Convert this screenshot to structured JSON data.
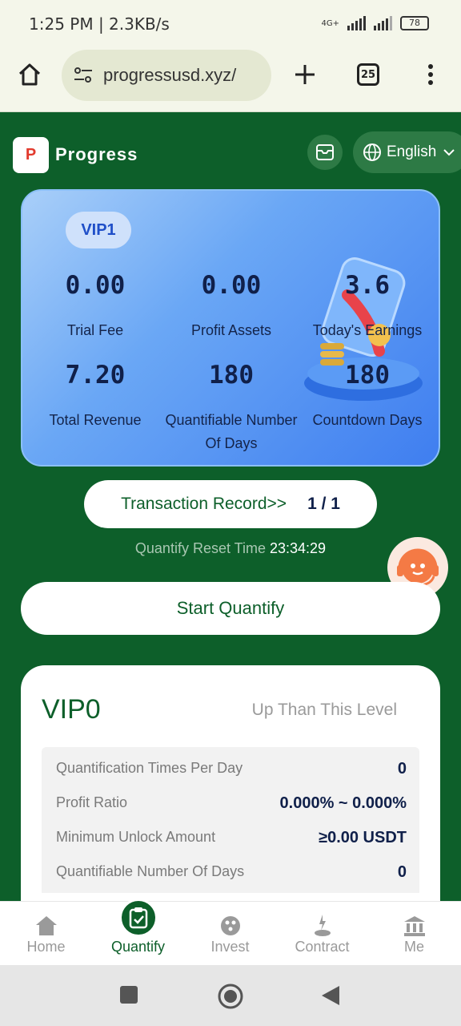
{
  "status_bar": {
    "time": "1:25 PM | 2.3KB/s",
    "network": "4G+",
    "battery": "78"
  },
  "browser": {
    "url": "progressusd.xyz/",
    "tab_count": "25"
  },
  "header": {
    "logo_text": "P",
    "app_name": "Progress",
    "language": "English"
  },
  "vip_card": {
    "badge": "VIP1",
    "stats": [
      {
        "value": "0.00",
        "label": "Trial Fee"
      },
      {
        "value": "0.00",
        "label": "Profit Assets"
      },
      {
        "value": "3.6",
        "label": "Today's Earnings"
      },
      {
        "value": "7.20",
        "label": "Total Revenue"
      },
      {
        "value": "180",
        "label": "Quantifiable Number Of Days"
      },
      {
        "value": "180",
        "label": "Countdown Days"
      }
    ]
  },
  "transaction": {
    "label": "Transaction Record>>",
    "count": "1 / 1"
  },
  "reset": {
    "label": "Quantify Reset Time",
    "time": "23:34:29"
  },
  "start_button": "Start Quantify",
  "level_panel": {
    "title": "VIP0",
    "hint": "Up Than This Level",
    "rows": [
      {
        "key": "Quantification Times Per Day",
        "value": "0"
      },
      {
        "key": "Profit Ratio",
        "value": "0.000% ~ 0.000%"
      },
      {
        "key": "Minimum Unlock Amount",
        "value": "≥0.00 USDT"
      },
      {
        "key": "Quantifiable Number Of Days",
        "value": "0"
      }
    ]
  },
  "tabbar": [
    {
      "label": "Home",
      "icon": "home-icon",
      "active": false
    },
    {
      "label": "Quantify",
      "icon": "clipboard-icon",
      "active": true
    },
    {
      "label": "Invest",
      "icon": "invest-icon",
      "active": false
    },
    {
      "label": "Contract",
      "icon": "contract-icon",
      "active": false
    },
    {
      "label": "Me",
      "icon": "bank-icon",
      "active": false
    }
  ],
  "colors": {
    "brand_green": "#0d5f2a",
    "card_blue": "#3f7ef0",
    "accent_red": "#e23a2d"
  }
}
